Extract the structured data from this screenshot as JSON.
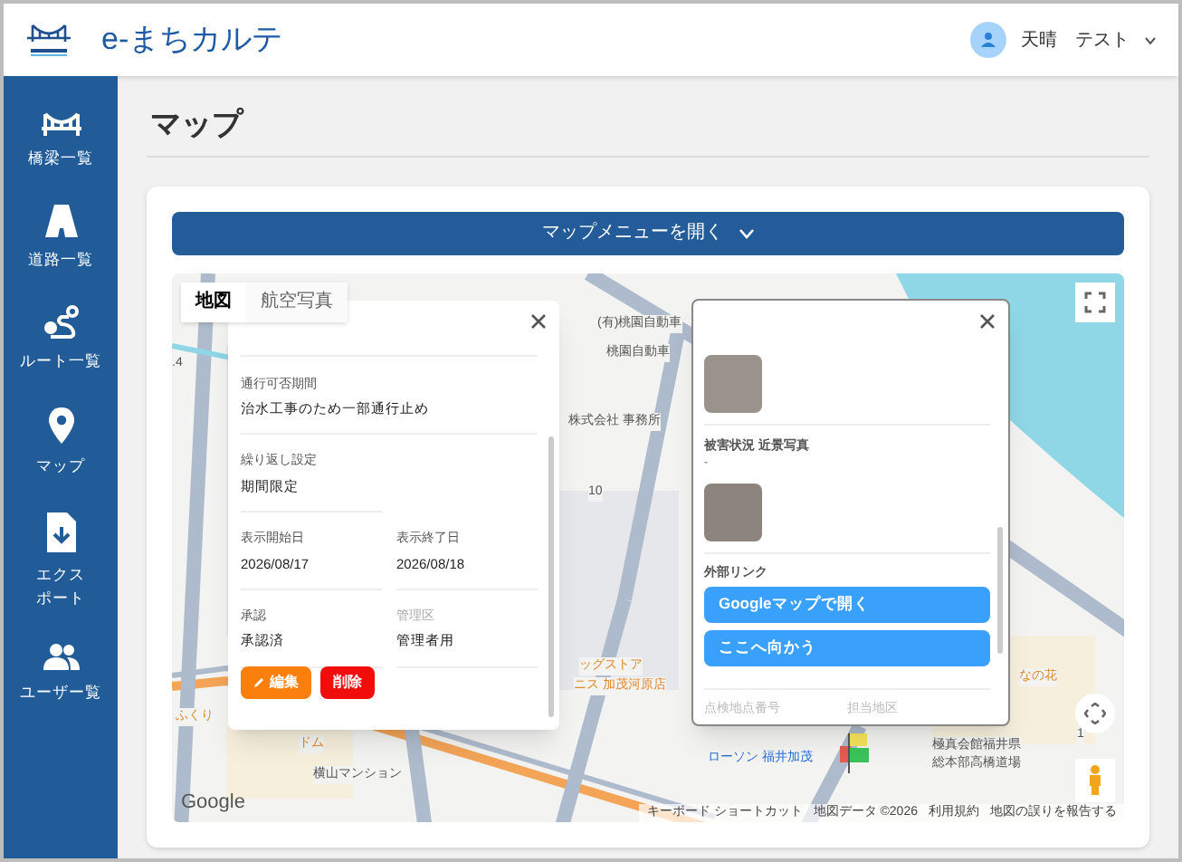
{
  "app": {
    "title": "e-まちカルテ"
  },
  "user": {
    "name": "天晴　テスト"
  },
  "sidebar": {
    "items": [
      {
        "label": "橋梁一覧",
        "kind": "bridge"
      },
      {
        "label": "道路一覧",
        "kind": "road"
      },
      {
        "label": "ルート一覧",
        "kind": "route"
      },
      {
        "label": "マップ",
        "kind": "pin"
      },
      {
        "label": "エクスポート",
        "kind": "export"
      },
      {
        "label": "ユーザー覧",
        "kind": "users"
      }
    ]
  },
  "page": {
    "title": "マップ"
  },
  "map_menu_button": {
    "label": "マップメニューを開く"
  },
  "map": {
    "tabs": [
      {
        "label": "地図",
        "selected": true
      },
      {
        "label": "航空写真",
        "selected": false
      }
    ],
    "labels": [
      {
        "text": "(有)桃園自動車"
      },
      {
        "text": "桃園自動車"
      },
      {
        "text": "株式会社 事務所"
      },
      {
        "text": "10"
      },
      {
        "text": ".4"
      },
      {
        "text": "ッグストア"
      },
      {
        "text": "ニス 加茂河原店"
      },
      {
        "text": "なの花"
      },
      {
        "text": "ふくり"
      },
      {
        "text": "ドム"
      },
      {
        "text": "横山マンション"
      },
      {
        "text": "ローソン 福井加茂"
      },
      {
        "text": "極真会館福井県"
      },
      {
        "text": "総本部高橋道場"
      },
      {
        "text": "1"
      }
    ],
    "footer": [
      "キーボード ショートカット",
      "地図データ ©2026",
      "利用規約",
      "地図の誤りを報告する"
    ],
    "google_logo": "Google"
  },
  "popup_left": {
    "fields": [
      {
        "label": "通行可否期間",
        "value": "治水工事のため一部通行止め",
        "wide": true,
        "muted": false
      },
      {
        "label": "繰り返し設定",
        "value": "期間限定",
        "wide": false,
        "muted": false
      },
      {
        "label": "表示開始日",
        "value": "2026/08/17",
        "wide": false,
        "muted": false
      },
      {
        "label": "表示終了日",
        "value": "2026/08/18",
        "wide": false,
        "muted": false
      },
      {
        "label": "承認",
        "value": "承認済",
        "wide": false,
        "muted": false
      },
      {
        "label": "管理区",
        "value": "管理者用",
        "wide": false,
        "muted": true
      }
    ],
    "buttons": [
      {
        "label": "編集",
        "kind": "edit"
      },
      {
        "label": "削除",
        "kind": "delete"
      }
    ]
  },
  "popup_right": {
    "photo_caption": "被害状況 近景写真",
    "photo_note": "-",
    "links_title": "外部リンク",
    "links": [
      "Googleマップで開く",
      "ここへ向かう"
    ],
    "bottom_labels": [
      "点検地点番号",
      "担当地区"
    ]
  }
}
